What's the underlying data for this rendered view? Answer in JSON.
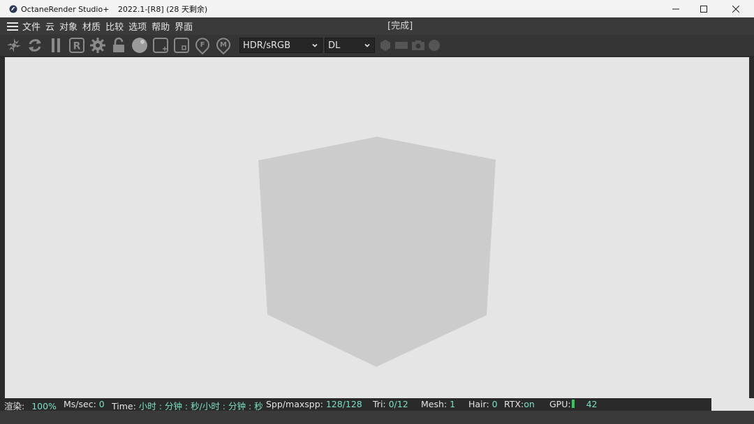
{
  "window": {
    "app_name": "OctaneRender Studio+",
    "version_text": "2022.1-[R8] (28 天剩余)",
    "icons": [
      "app-logo-icon",
      "minimize-icon",
      "maximize-icon",
      "close-icon"
    ]
  },
  "menubar": {
    "items": [
      "文件",
      "云",
      "对象",
      "材质",
      "比较",
      "选项",
      "帮助",
      "界面"
    ],
    "status": "[完成]"
  },
  "toolbar": {
    "icons": [
      "send-scene-icon",
      "restart-render-icon",
      "pause-icon",
      "region-render-icon",
      "settings-gear-icon",
      "lock-icon",
      "material-ball-icon",
      "add-region-icon",
      "film-region-icon",
      "focus-pick-icon",
      "material-pick-icon"
    ],
    "region_label": "R",
    "focus_label": "F",
    "material_label": "M",
    "color_space": "HDR/sRGB",
    "kernel": "DL",
    "dim_icons": [
      "cube-icon",
      "viewport-icon",
      "camera-icon",
      "sphere-icon"
    ]
  },
  "statusbar": {
    "render_label": "渲染:",
    "render_value": "100%",
    "ms_label": "Ms/sec:",
    "ms_value": "0",
    "time_label": "Time:",
    "time_value": "小时 : 分钟 : 秒/小时 : 分钟 : 秒",
    "spp_label": "Spp/maxspp:",
    "spp_value": "128/128",
    "tri_label": "Tri:",
    "tri_value": "0/12",
    "mesh_label": "Mesh:",
    "mesh_value": "1",
    "hair_label": "Hair:",
    "hair_value": "0",
    "rtx_label": "RTX:",
    "rtx_value": "on",
    "gpu_label": "GPU:",
    "gpu_value": "42",
    "colors": {
      "value": "#7be0c7",
      "gpu_bar": "#36c85a"
    }
  },
  "viewport": {
    "background": "#e5e5e5",
    "cube_color": "#cccccc"
  }
}
